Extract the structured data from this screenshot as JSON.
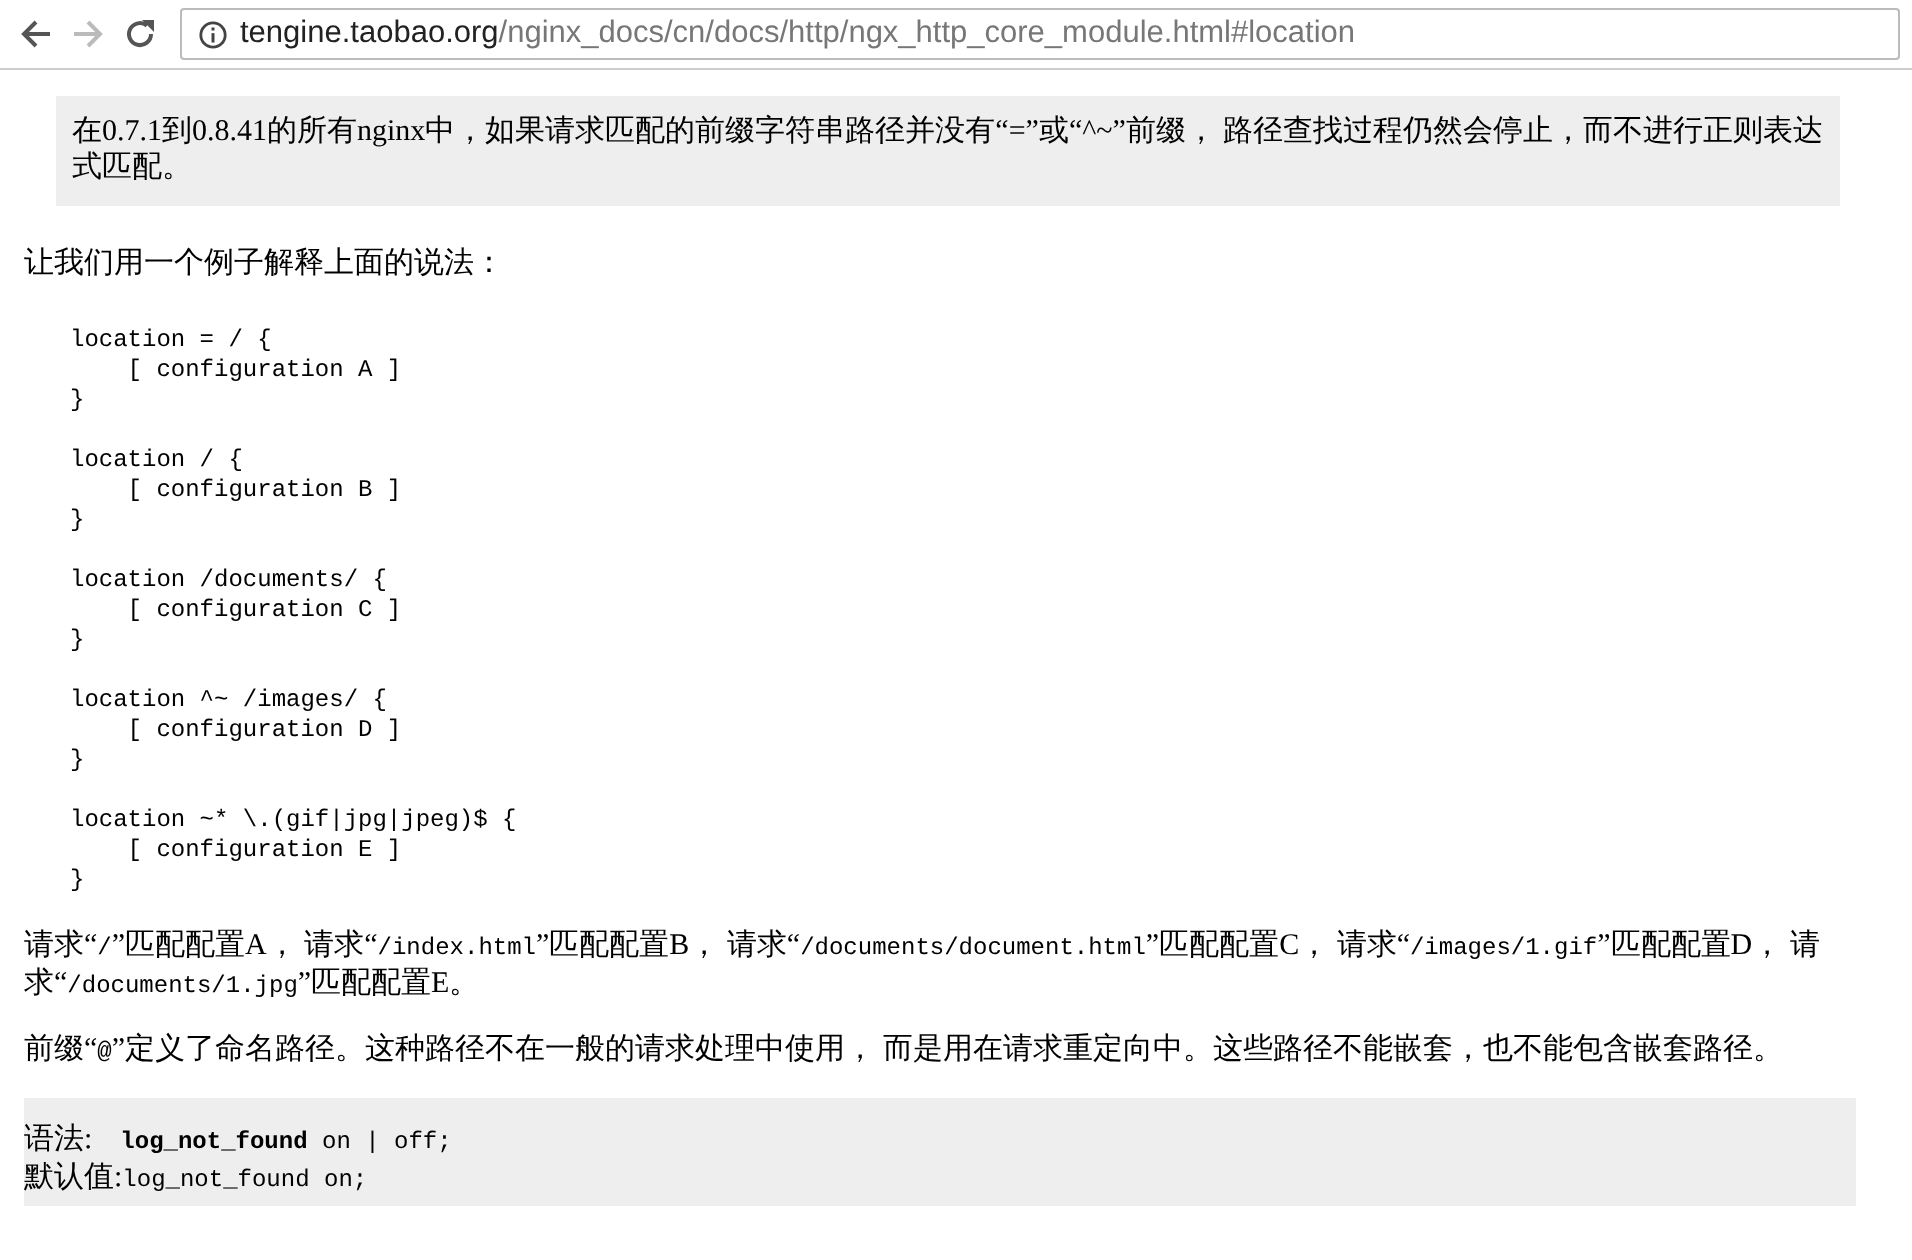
{
  "toolbar": {
    "url_host": "tengine.taobao.org",
    "url_path": "/nginx_docs/cn/docs/http/ngx_http_core_module.html#location",
    "back_disabled": false,
    "forward_disabled": true
  },
  "note": "在0.7.1到0.8.41的所有nginx中，如果请求匹配的前缀字符串路径并没有“=”或“^~”前缀， 路径查找过程仍然会停止，而不进行正则表达式匹配。",
  "intro": "让我们用一个例子解释上面的说法：",
  "code_blocks": [
    [
      "location = / {",
      "    [ configuration A ]",
      "}"
    ],
    [
      "location / {",
      "    [ configuration B ]",
      "}"
    ],
    [
      "location /documents/ {",
      "    [ configuration C ]",
      "}"
    ],
    [
      "location ^~ /images/ {",
      "    [ configuration D ]",
      "}"
    ],
    [
      "location ~* \\.(gif|jpg|jpeg)$ {",
      "    [ configuration E ]",
      "}"
    ]
  ],
  "paragraphs": [
    [
      {
        "kind": "plain",
        "text": "请求“"
      },
      {
        "kind": "code",
        "text": "/"
      },
      {
        "kind": "plain",
        "text": "”匹配配置A， 请求“"
      },
      {
        "kind": "code",
        "text": "/index.html"
      },
      {
        "kind": "plain",
        "text": "”匹配配置B， 请求“"
      },
      {
        "kind": "code",
        "text": "/documents/document.html"
      },
      {
        "kind": "plain",
        "text": "”匹配配置C， 请求“"
      },
      {
        "kind": "code",
        "text": "/images/1.gif"
      },
      {
        "kind": "plain",
        "text": "”匹配配置D， 请求“"
      },
      {
        "kind": "code",
        "text": "/documents/1.jpg"
      },
      {
        "kind": "plain",
        "text": "”匹配配置E。"
      }
    ],
    [
      {
        "kind": "plain",
        "text": "前缀“"
      },
      {
        "kind": "code",
        "text": "@"
      },
      {
        "kind": "plain",
        "text": "”定义了命名路径。这种路径不在一般的请求处理中使用， 而是用在请求重定向中。这些路径不能嵌套，也不能包含嵌套路径。"
      }
    ]
  ],
  "syntax": {
    "rows": [
      {
        "label": "语法:",
        "parts": [
          {
            "kind": "bold",
            "text": "log_not_found"
          },
          {
            "kind": "code",
            "text": " on | off;"
          }
        ]
      },
      {
        "label": "默认值:",
        "parts": [
          {
            "kind": "code",
            "text": "log_not_found on;"
          }
        ]
      }
    ]
  }
}
